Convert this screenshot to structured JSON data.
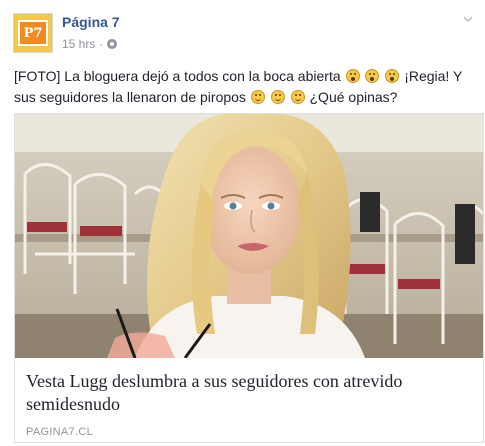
{
  "post": {
    "page_name": "Página 7",
    "avatar_text": "P7",
    "timestamp": "15 hrs",
    "separator": "·",
    "text_part1": "[FOTO] La bloguera dejó a todos con la boca abierta",
    "text_part2": "¡Regia! Y sus seguidores la llenaron de piropos",
    "text_part3": "¿Qué opinas?"
  },
  "link_card": {
    "title": "Vesta Lugg deslumbra a sus seguidores con atrevido semidesnudo",
    "domain": "PAGINA7.CL"
  },
  "icons": {
    "avatar": "page-logo",
    "privacy": "globe-icon",
    "menu": "chevron-down-icon",
    "emoji_wow": "wow-emoji",
    "emoji_smile": "smile-emoji"
  }
}
